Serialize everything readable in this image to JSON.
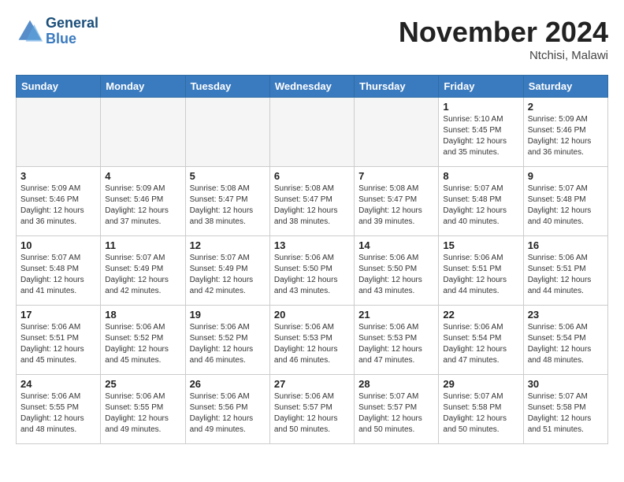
{
  "header": {
    "logo_line1": "General",
    "logo_line2": "Blue",
    "month_title": "November 2024",
    "location": "Ntchisi, Malawi"
  },
  "weekdays": [
    "Sunday",
    "Monday",
    "Tuesday",
    "Wednesday",
    "Thursday",
    "Friday",
    "Saturday"
  ],
  "weeks": [
    [
      {
        "day": "",
        "info": ""
      },
      {
        "day": "",
        "info": ""
      },
      {
        "day": "",
        "info": ""
      },
      {
        "day": "",
        "info": ""
      },
      {
        "day": "",
        "info": ""
      },
      {
        "day": "1",
        "info": "Sunrise: 5:10 AM\nSunset: 5:45 PM\nDaylight: 12 hours\nand 35 minutes."
      },
      {
        "day": "2",
        "info": "Sunrise: 5:09 AM\nSunset: 5:46 PM\nDaylight: 12 hours\nand 36 minutes."
      }
    ],
    [
      {
        "day": "3",
        "info": "Sunrise: 5:09 AM\nSunset: 5:46 PM\nDaylight: 12 hours\nand 36 minutes."
      },
      {
        "day": "4",
        "info": "Sunrise: 5:09 AM\nSunset: 5:46 PM\nDaylight: 12 hours\nand 37 minutes."
      },
      {
        "day": "5",
        "info": "Sunrise: 5:08 AM\nSunset: 5:47 PM\nDaylight: 12 hours\nand 38 minutes."
      },
      {
        "day": "6",
        "info": "Sunrise: 5:08 AM\nSunset: 5:47 PM\nDaylight: 12 hours\nand 38 minutes."
      },
      {
        "day": "7",
        "info": "Sunrise: 5:08 AM\nSunset: 5:47 PM\nDaylight: 12 hours\nand 39 minutes."
      },
      {
        "day": "8",
        "info": "Sunrise: 5:07 AM\nSunset: 5:48 PM\nDaylight: 12 hours\nand 40 minutes."
      },
      {
        "day": "9",
        "info": "Sunrise: 5:07 AM\nSunset: 5:48 PM\nDaylight: 12 hours\nand 40 minutes."
      }
    ],
    [
      {
        "day": "10",
        "info": "Sunrise: 5:07 AM\nSunset: 5:48 PM\nDaylight: 12 hours\nand 41 minutes."
      },
      {
        "day": "11",
        "info": "Sunrise: 5:07 AM\nSunset: 5:49 PM\nDaylight: 12 hours\nand 42 minutes."
      },
      {
        "day": "12",
        "info": "Sunrise: 5:07 AM\nSunset: 5:49 PM\nDaylight: 12 hours\nand 42 minutes."
      },
      {
        "day": "13",
        "info": "Sunrise: 5:06 AM\nSunset: 5:50 PM\nDaylight: 12 hours\nand 43 minutes."
      },
      {
        "day": "14",
        "info": "Sunrise: 5:06 AM\nSunset: 5:50 PM\nDaylight: 12 hours\nand 43 minutes."
      },
      {
        "day": "15",
        "info": "Sunrise: 5:06 AM\nSunset: 5:51 PM\nDaylight: 12 hours\nand 44 minutes."
      },
      {
        "day": "16",
        "info": "Sunrise: 5:06 AM\nSunset: 5:51 PM\nDaylight: 12 hours\nand 44 minutes."
      }
    ],
    [
      {
        "day": "17",
        "info": "Sunrise: 5:06 AM\nSunset: 5:51 PM\nDaylight: 12 hours\nand 45 minutes."
      },
      {
        "day": "18",
        "info": "Sunrise: 5:06 AM\nSunset: 5:52 PM\nDaylight: 12 hours\nand 45 minutes."
      },
      {
        "day": "19",
        "info": "Sunrise: 5:06 AM\nSunset: 5:52 PM\nDaylight: 12 hours\nand 46 minutes."
      },
      {
        "day": "20",
        "info": "Sunrise: 5:06 AM\nSunset: 5:53 PM\nDaylight: 12 hours\nand 46 minutes."
      },
      {
        "day": "21",
        "info": "Sunrise: 5:06 AM\nSunset: 5:53 PM\nDaylight: 12 hours\nand 47 minutes."
      },
      {
        "day": "22",
        "info": "Sunrise: 5:06 AM\nSunset: 5:54 PM\nDaylight: 12 hours\nand 47 minutes."
      },
      {
        "day": "23",
        "info": "Sunrise: 5:06 AM\nSunset: 5:54 PM\nDaylight: 12 hours\nand 48 minutes."
      }
    ],
    [
      {
        "day": "24",
        "info": "Sunrise: 5:06 AM\nSunset: 5:55 PM\nDaylight: 12 hours\nand 48 minutes."
      },
      {
        "day": "25",
        "info": "Sunrise: 5:06 AM\nSunset: 5:55 PM\nDaylight: 12 hours\nand 49 minutes."
      },
      {
        "day": "26",
        "info": "Sunrise: 5:06 AM\nSunset: 5:56 PM\nDaylight: 12 hours\nand 49 minutes."
      },
      {
        "day": "27",
        "info": "Sunrise: 5:06 AM\nSunset: 5:57 PM\nDaylight: 12 hours\nand 50 minutes."
      },
      {
        "day": "28",
        "info": "Sunrise: 5:07 AM\nSunset: 5:57 PM\nDaylight: 12 hours\nand 50 minutes."
      },
      {
        "day": "29",
        "info": "Sunrise: 5:07 AM\nSunset: 5:58 PM\nDaylight: 12 hours\nand 50 minutes."
      },
      {
        "day": "30",
        "info": "Sunrise: 5:07 AM\nSunset: 5:58 PM\nDaylight: 12 hours\nand 51 minutes."
      }
    ]
  ]
}
